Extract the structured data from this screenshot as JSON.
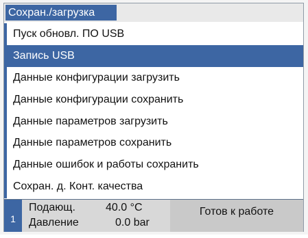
{
  "window": {
    "title": "Сохран./загрузка"
  },
  "menu": {
    "items": [
      {
        "label": "Пуск обновл. ПО USB",
        "selected": false
      },
      {
        "label": "Запись USB",
        "selected": true
      },
      {
        "label": "Данные конфигурации загрузить",
        "selected": false
      },
      {
        "label": "Данные конфигурации сохранить",
        "selected": false
      },
      {
        "label": "Данные параметров загрузить",
        "selected": false
      },
      {
        "label": "Данные параметров сохранить",
        "selected": false
      },
      {
        "label": "Данные ошибок и работы сохранить",
        "selected": false
      },
      {
        "label": "Сохран. д. Конт. качества",
        "selected": false
      }
    ]
  },
  "status": {
    "index": "1",
    "flow_label": "Подающ.",
    "flow_value": "40.0 °C",
    "pressure_label": "Давление",
    "pressure_value": "0.0 bar",
    "state": "Готов к работе"
  },
  "colors": {
    "accent": "#3d66a3",
    "status_bg": "#d8d8d8",
    "state_bg": "#c9c9c9"
  }
}
